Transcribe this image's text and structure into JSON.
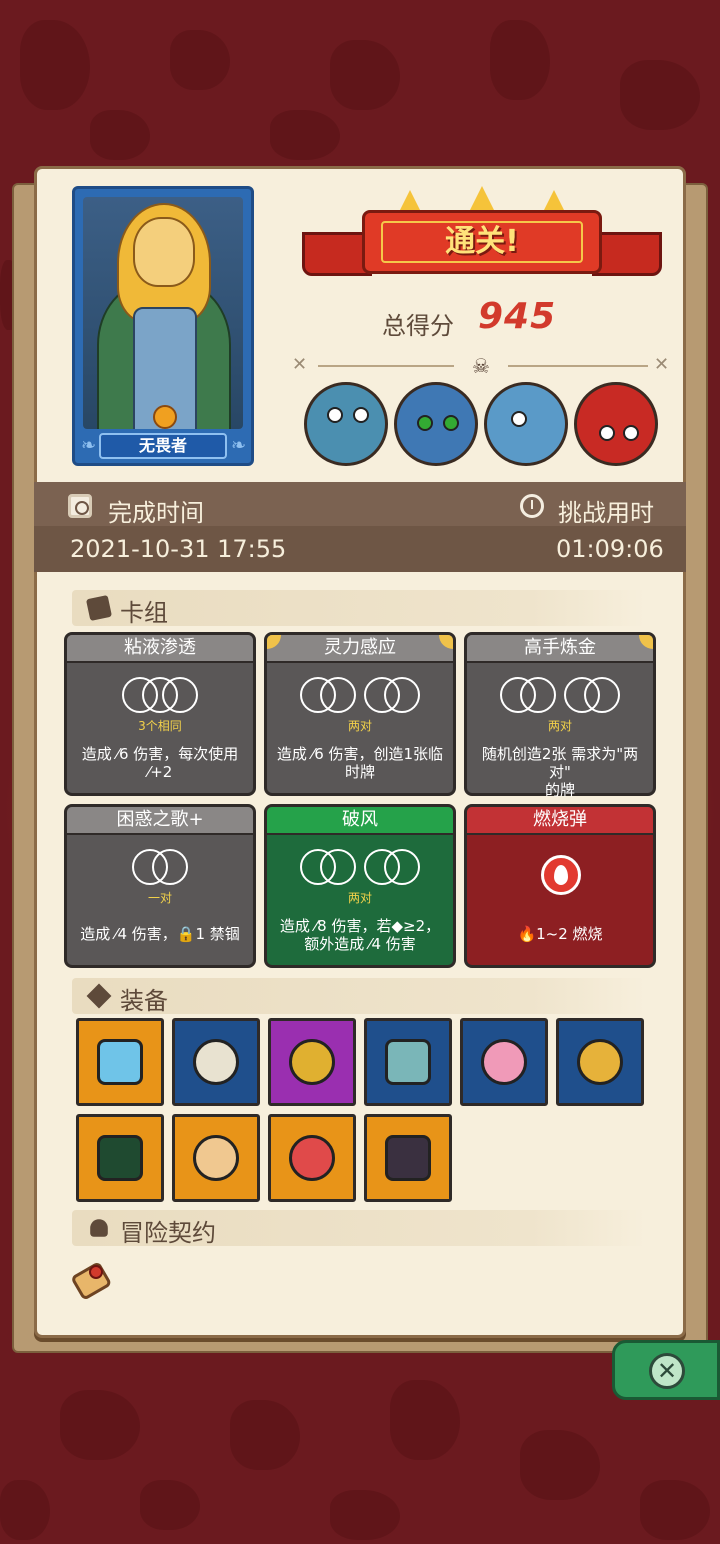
{
  "hero": {
    "name": "无畏者"
  },
  "banner": {
    "title": "通关!"
  },
  "score": {
    "label": "总得分",
    "value": "945"
  },
  "bosses": [
    {
      "name": "boss-1",
      "color": "#4b8fb0"
    },
    {
      "name": "boss-2",
      "color": "#3f78b4"
    },
    {
      "name": "boss-3",
      "color": "#5a9ac8"
    },
    {
      "name": "boss-4",
      "color": "#c82a24"
    }
  ],
  "info": {
    "finish_label": "完成时间",
    "finish_value": "2021-10-31 17:55",
    "duration_label": "挑战用时",
    "duration_value": "01:09:06"
  },
  "sections": {
    "deck": "卡组",
    "equipment": "装备",
    "contract": "冒险契约"
  },
  "cards": [
    {
      "title": "粘液渗透",
      "cond": "3个相同",
      "desc1": "造成 ⁄6 伤害，每次使用",
      "desc2": "⁄+2"
    },
    {
      "title": "灵力感应",
      "cond": "两对",
      "desc1": "造成 ⁄6 伤害，创造1张临",
      "desc2": "时牌"
    },
    {
      "title": "高手炼金",
      "cond": "两对",
      "desc1": "随机创造2张 需求为\"两对\"",
      "desc2": "的牌"
    },
    {
      "title": "困惑之歌+",
      "cond": "一对",
      "desc1": "造成 ⁄4 伤害，🔒1 禁锢",
      "desc2": ""
    },
    {
      "title": "破风",
      "cond": "两对",
      "desc1": "造成 ⁄8 伤害，若◆≥2，",
      "desc2": "额外造成 ⁄4 伤害"
    },
    {
      "title": "燃烧弹",
      "cond": "",
      "desc1": "🔥1~2 燃烧",
      "desc2": ""
    }
  ],
  "equipment": [
    {
      "name": "shield-charm",
      "bg": "#e89418",
      "gem": "#6fc4e8"
    },
    {
      "name": "horned-skull",
      "bg": "#1f4f8c",
      "gem": "#e8e2d0"
    },
    {
      "name": "green-ring",
      "bg": "#9a2fb0",
      "gem": "#e0b030"
    },
    {
      "name": "axe",
      "bg": "#1f4f8c",
      "gem": "#7ab6b8"
    },
    {
      "name": "pink-gem",
      "bg": "#1f4f8c",
      "gem": "#f09ab8"
    },
    {
      "name": "gold-ring",
      "bg": "#1f4f8c",
      "gem": "#e6b23a"
    },
    {
      "name": "dark-horseshoe",
      "bg": "#e89418",
      "gem": "#1f4a30"
    },
    {
      "name": "round-amulet",
      "bg": "#e89418",
      "gem": "#f0c890"
    },
    {
      "name": "red-potion",
      "bg": "#e89418",
      "gem": "#e04a4a"
    },
    {
      "name": "star-triangle",
      "bg": "#e89418",
      "gem": "#3a3040"
    }
  ]
}
